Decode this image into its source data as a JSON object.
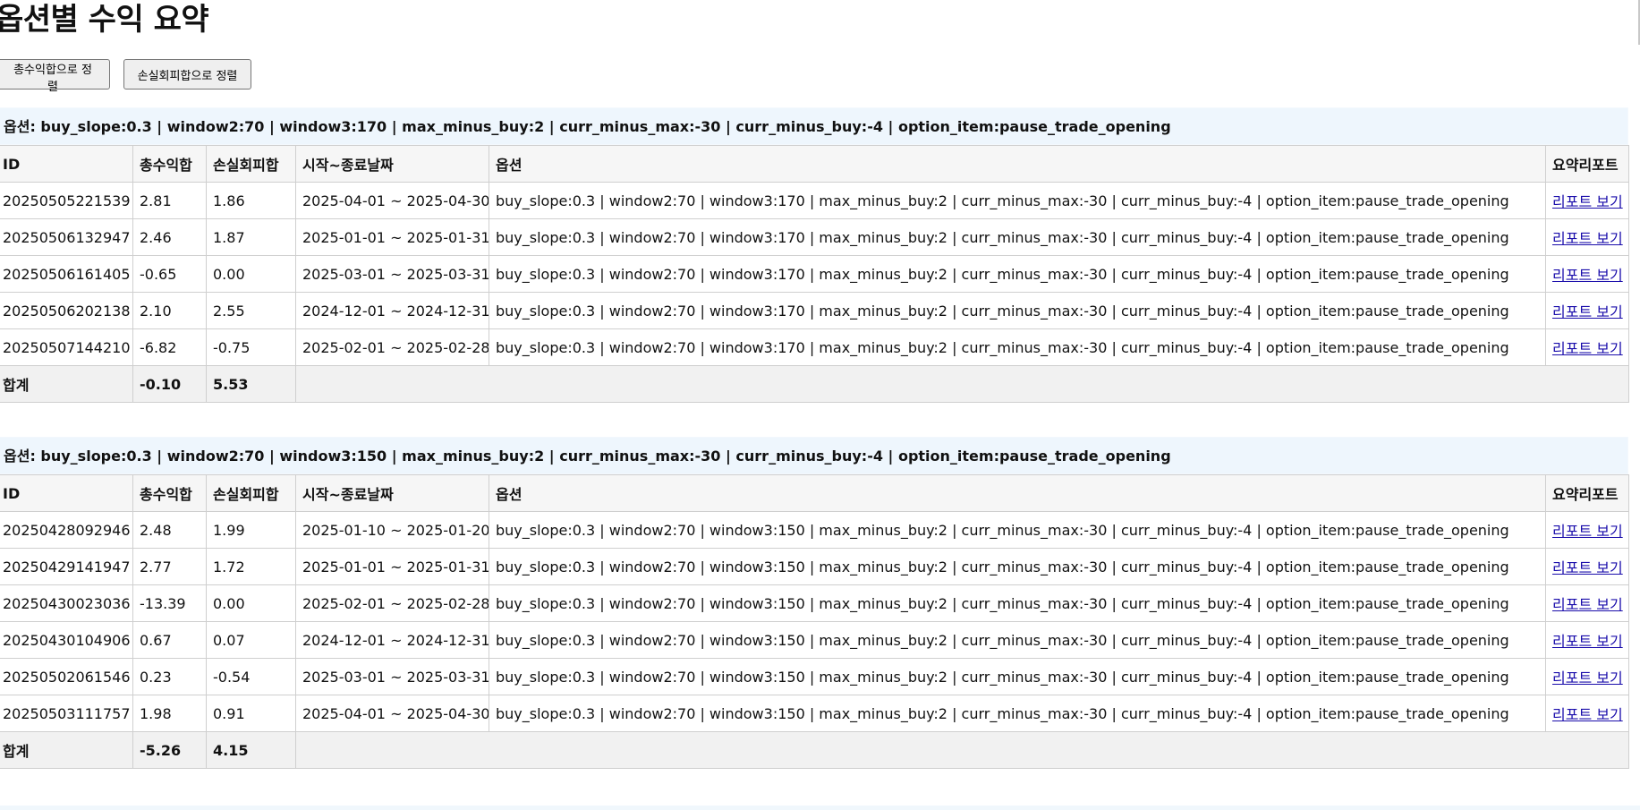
{
  "page": {
    "title": "옵션별 수익 요약",
    "sort_total_label": "총수익합으로 정렬",
    "sort_loss_label": "손실회피합으로 정렬"
  },
  "groups": [
    {
      "header": "옵션: buy_slope:0.3 | window2:70 | window3:170 | max_minus_buy:2 | curr_minus_max:-30 | curr_minus_buy:-4 | option_item:pause_trade_opening",
      "columns": [
        "ID",
        "총수익합",
        "손실회피합",
        "시작~종료날짜",
        "옵션",
        "요약리포트"
      ],
      "rows": [
        {
          "id": "20250505221539",
          "total": "2.81",
          "loss": "1.86",
          "dates": "2025-04-01 ~ 2025-04-30",
          "options": "buy_slope:0.3 | window2:70 | window3:170 | max_minus_buy:2 | curr_minus_max:-30 | curr_minus_buy:-4 | option_item:pause_trade_opening",
          "report": "리포트 보기"
        },
        {
          "id": "20250506132947",
          "total": "2.46",
          "loss": "1.87",
          "dates": "2025-01-01 ~ 2025-01-31",
          "options": "buy_slope:0.3 | window2:70 | window3:170 | max_minus_buy:2 | curr_minus_max:-30 | curr_minus_buy:-4 | option_item:pause_trade_opening",
          "report": "리포트 보기"
        },
        {
          "id": "20250506161405",
          "total": "-0.65",
          "loss": "0.00",
          "dates": "2025-03-01 ~ 2025-03-31",
          "options": "buy_slope:0.3 | window2:70 | window3:170 | max_minus_buy:2 | curr_minus_max:-30 | curr_minus_buy:-4 | option_item:pause_trade_opening",
          "report": "리포트 보기"
        },
        {
          "id": "20250506202138",
          "total": "2.10",
          "loss": "2.55",
          "dates": "2024-12-01 ~ 2024-12-31",
          "options": "buy_slope:0.3 | window2:70 | window3:170 | max_minus_buy:2 | curr_minus_max:-30 | curr_minus_buy:-4 | option_item:pause_trade_opening",
          "report": "리포트 보기"
        },
        {
          "id": "20250507144210",
          "total": "-6.82",
          "loss": "-0.75",
          "dates": "2025-02-01 ~ 2025-02-28",
          "options": "buy_slope:0.3 | window2:70 | window3:170 | max_minus_buy:2 | curr_minus_max:-30 | curr_minus_buy:-4 | option_item:pause_trade_opening",
          "report": "리포트 보기"
        }
      ],
      "total_row": {
        "label": "합계",
        "total": "-0.10",
        "loss": "5.53"
      }
    },
    {
      "header": "옵션: buy_slope:0.3 | window2:70 | window3:150 | max_minus_buy:2 | curr_minus_max:-30 | curr_minus_buy:-4 | option_item:pause_trade_opening",
      "columns": [
        "ID",
        "총수익합",
        "손실회피합",
        "시작~종료날짜",
        "옵션",
        "요약리포트"
      ],
      "rows": [
        {
          "id": "20250428092946",
          "total": "2.48",
          "loss": "1.99",
          "dates": "2025-01-10 ~ 2025-01-20",
          "options": "buy_slope:0.3 | window2:70 | window3:150 | max_minus_buy:2 | curr_minus_max:-30 | curr_minus_buy:-4 | option_item:pause_trade_opening",
          "report": "리포트 보기"
        },
        {
          "id": "20250429141947",
          "total": "2.77",
          "loss": "1.72",
          "dates": "2025-01-01 ~ 2025-01-31",
          "options": "buy_slope:0.3 | window2:70 | window3:150 | max_minus_buy:2 | curr_minus_max:-30 | curr_minus_buy:-4 | option_item:pause_trade_opening",
          "report": "리포트 보기"
        },
        {
          "id": "20250430023036",
          "total": "-13.39",
          "loss": "0.00",
          "dates": "2025-02-01 ~ 2025-02-28",
          "options": "buy_slope:0.3 | window2:70 | window3:150 | max_minus_buy:2 | curr_minus_max:-30 | curr_minus_buy:-4 | option_item:pause_trade_opening",
          "report": "리포트 보기"
        },
        {
          "id": "20250430104906",
          "total": "0.67",
          "loss": "0.07",
          "dates": "2024-12-01 ~ 2024-12-31",
          "options": "buy_slope:0.3 | window2:70 | window3:150 | max_minus_buy:2 | curr_minus_max:-30 | curr_minus_buy:-4 | option_item:pause_trade_opening",
          "report": "리포트 보기"
        },
        {
          "id": "20250502061546",
          "total": "0.23",
          "loss": "-0.54",
          "dates": "2025-03-01 ~ 2025-03-31",
          "options": "buy_slope:0.3 | window2:70 | window3:150 | max_minus_buy:2 | curr_minus_max:-30 | curr_minus_buy:-4 | option_item:pause_trade_opening",
          "report": "리포트 보기"
        },
        {
          "id": "20250503111757",
          "total": "1.98",
          "loss": "0.91",
          "dates": "2025-04-01 ~ 2025-04-30",
          "options": "buy_slope:0.3 | window2:70 | window3:150 | max_minus_buy:2 | curr_minus_max:-30 | curr_minus_buy:-4 | option_item:pause_trade_opening",
          "report": "리포트 보기"
        }
      ],
      "total_row": {
        "label": "합계",
        "total": "-5.26",
        "loss": "4.15"
      }
    }
  ]
}
